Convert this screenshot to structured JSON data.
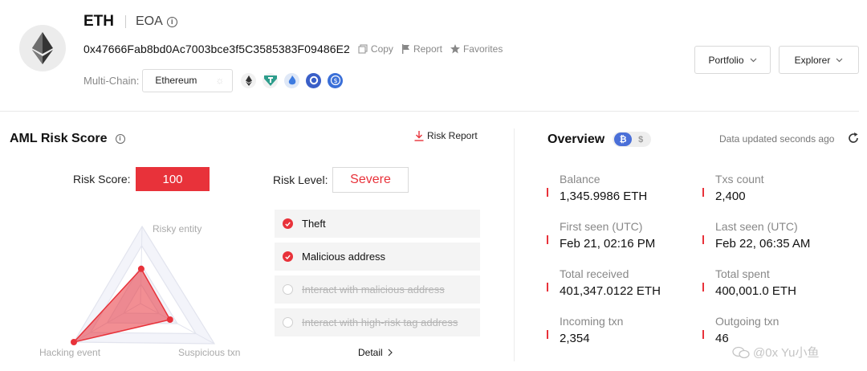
{
  "header": {
    "coin_icon": "ethereum-logo",
    "title": "ETH",
    "account_type": "EOA",
    "address": "0x47666Fab8bd0Ac7003bce3f5C3585383F09486E2",
    "actions": {
      "copy": "Copy",
      "report": "Report",
      "favorites": "Favorites"
    },
    "multichain_label": "Multi-Chain:",
    "chain_selected": "Ethereum",
    "chain_icons": [
      "ethereum-icon",
      "tron-icon",
      "bnb-icon",
      "arbitrum-icon",
      "usdc-icon"
    ],
    "buttons": {
      "portfolio": "Portfolio",
      "explorer": "Explorer"
    }
  },
  "aml": {
    "title": "AML Risk Score",
    "risk_report": "Risk Report",
    "risk_score_label": "Risk Score:",
    "risk_score": "100",
    "risk_level_label": "Risk Level:",
    "risk_level": "Severe",
    "radar": {
      "axes": [
        "Risky entity",
        "Suspicious txn",
        "Hacking event"
      ],
      "values": [
        0.45,
        0.4,
        1.0
      ]
    },
    "risk_items": [
      {
        "label": "Theft",
        "active": true
      },
      {
        "label": "Malicious address",
        "active": true
      },
      {
        "label": "Interact with malicious address",
        "active": false
      },
      {
        "label": "Interact with high-risk tag address",
        "active": false
      }
    ],
    "detail": "Detail"
  },
  "overview": {
    "title": "Overview",
    "currency_options": [
      "₿",
      "$"
    ],
    "currency_selected": "₿",
    "updated": "Data updated seconds ago",
    "stats": [
      {
        "label": "Balance",
        "value": "1,345.9986 ETH"
      },
      {
        "label": "Txs count",
        "value": "2,400"
      },
      {
        "label": "First seen (UTC)",
        "value": "Feb 21, 02:16 PM"
      },
      {
        "label": "Last seen (UTC)",
        "value": "Feb 22, 06:35 AM"
      },
      {
        "label": "Total received",
        "value": "401,347.0122 ETH"
      },
      {
        "label": "Total spent",
        "value": "400,001.0 ETH"
      },
      {
        "label": "Incoming txn",
        "value": "2,354"
      },
      {
        "label": "Outgoing txn",
        "value": "46"
      }
    ]
  },
  "watermark": "@0x Yu小鱼",
  "colors": {
    "accent_red": "#e8323a",
    "btc_blue": "#4a6fd8"
  }
}
